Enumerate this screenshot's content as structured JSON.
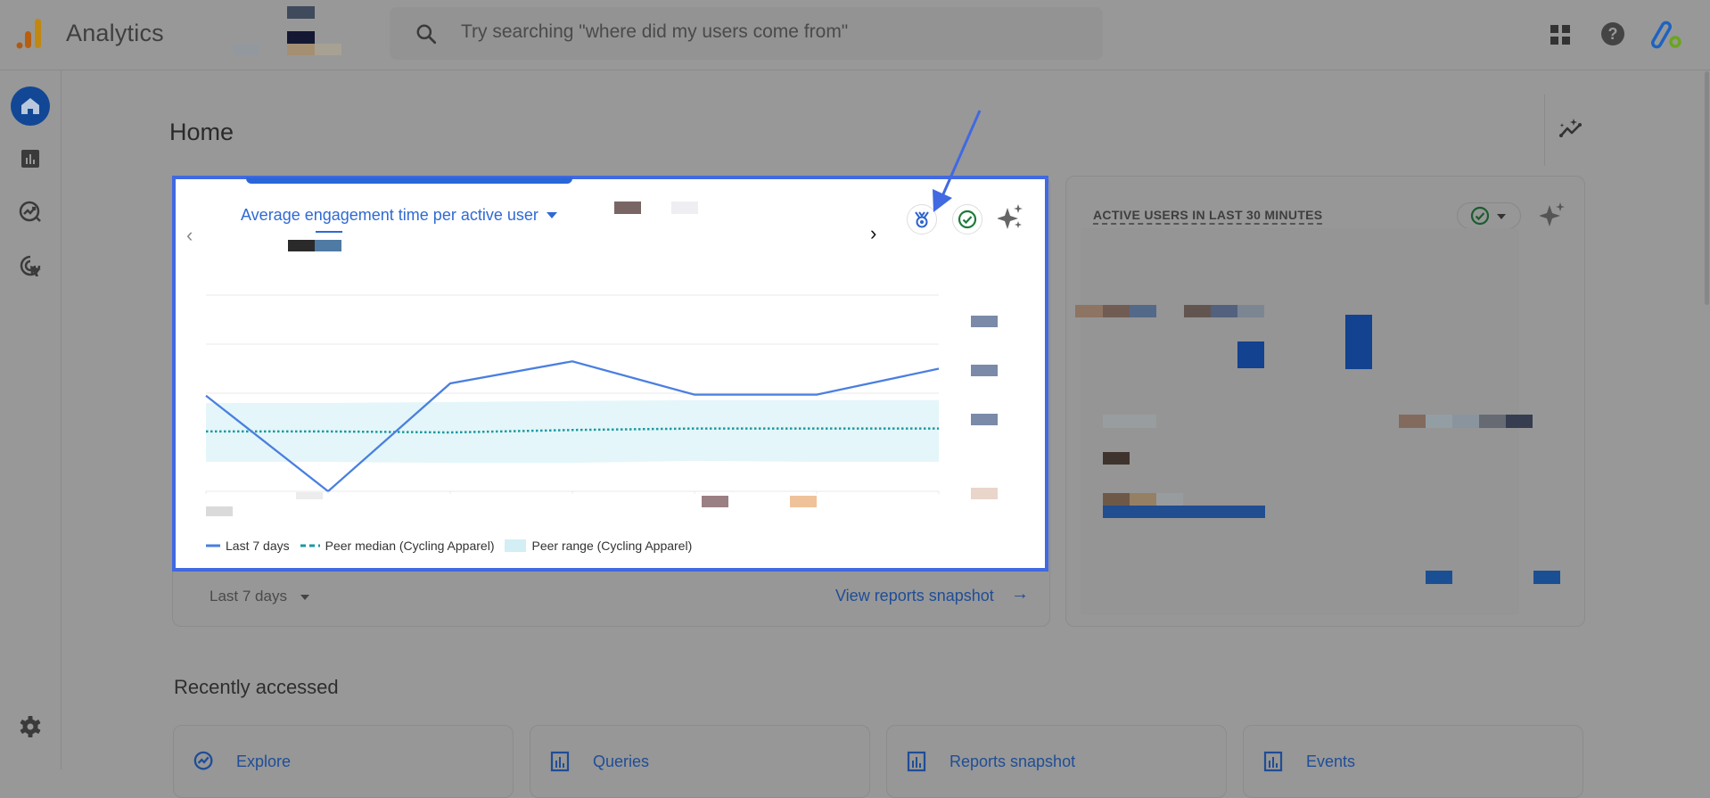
{
  "topbar": {
    "app_title": "Analytics",
    "search_placeholder": "Try searching \"where did my users come from\"",
    "icons": [
      "analytics-logo-icon",
      "search-icon",
      "apps-grid-icon",
      "help-icon",
      "account-icon"
    ],
    "help_glyph": "?"
  },
  "rail": {
    "items": [
      {
        "name": "Home",
        "icon": "home-icon",
        "active": true
      },
      {
        "name": "Reports",
        "icon": "reports-icon"
      },
      {
        "name": "Explore",
        "icon": "explore-icon"
      },
      {
        "name": "Advertising",
        "icon": "advertising-icon"
      }
    ],
    "settings_icon": "gear-icon"
  },
  "page": {
    "title": "Home",
    "insights_icon": "insights-icon"
  },
  "main_card": {
    "metric_label": "Average engagement time per active user",
    "prev_glyph": "‹",
    "next_glyph": "›",
    "date_range": "Last 7 days",
    "view_link": "View reports snapshot",
    "view_link_arrow": "→",
    "accent": "#4169e1"
  },
  "chart_data": {
    "type": "line",
    "title": "Average engagement time per active user",
    "x": [
      1,
      2,
      3,
      4,
      5,
      6,
      7
    ],
    "ylim": [
      0,
      4
    ],
    "grid": true,
    "series": [
      {
        "name": "Last 7 days",
        "style": "solid",
        "color": "#4a7fe0",
        "values": [
          1.95,
          0.0,
          2.2,
          2.65,
          1.97,
          1.97,
          2.5
        ]
      },
      {
        "name": "Peer median (Cycling Apparel)",
        "style": "dotted",
        "color": "#1a9aa0",
        "values": [
          1.22,
          1.22,
          1.2,
          1.25,
          1.28,
          1.28,
          1.28
        ]
      },
      {
        "name": "Peer range (Cycling Apparel)",
        "style": "band",
        "color": "#e4f6f9",
        "low": [
          0.0,
          0.0,
          0.0,
          0.0,
          0.0,
          0.0,
          0.0
        ],
        "lowv": [
          0.6,
          0.6,
          0.58,
          0.58,
          0.62,
          0.6,
          0.6
        ],
        "highv": [
          1.8,
          1.8,
          1.82,
          1.84,
          1.86,
          1.86,
          1.86
        ]
      }
    ],
    "legend": [
      {
        "label": "Last 7 days",
        "marker": "line"
      },
      {
        "label": "Peer median (Cycling Apparel)",
        "marker": "dashed"
      },
      {
        "label": "Peer range (Cycling Apparel)",
        "marker": "box"
      }
    ],
    "legend_position": "bottom-left"
  },
  "realtime_card": {
    "title": "ACTIVE USERS IN LAST 30 MINUTES"
  },
  "recent": {
    "title": "Recently accessed",
    "items": [
      {
        "label": "Explore",
        "icon": "explore-icon"
      },
      {
        "label": "Queries",
        "icon": "reports-icon"
      },
      {
        "label": "Reports snapshot",
        "icon": "reports-icon"
      },
      {
        "label": "Events",
        "icon": "reports-icon"
      }
    ]
  }
}
